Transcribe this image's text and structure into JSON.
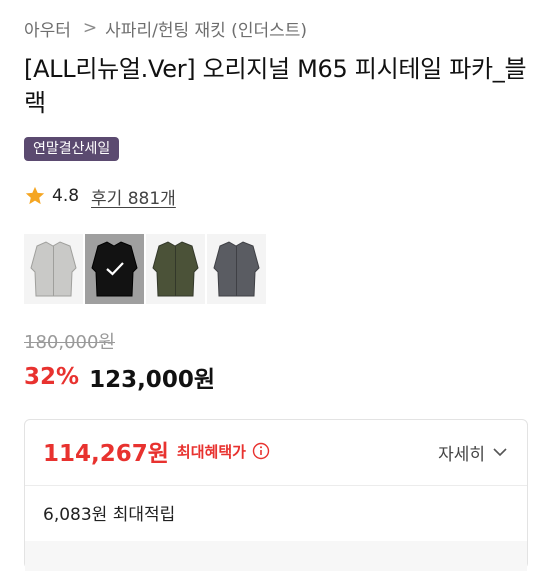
{
  "breadcrumb": {
    "category": "아우터",
    "separator": ">",
    "subcategory": "사파리/헌팅 재킷 (인더스트)"
  },
  "product": {
    "title": "[ALL리뉴얼.Ver] 오리지널 M65 피시테일 파카_블랙",
    "badge": "연말결산세일"
  },
  "rating": {
    "score": "4.8",
    "review_label": "후기 881개",
    "star_color": "#f5a623"
  },
  "options": {
    "thumbnails": [
      {
        "name": "light-gray-parka",
        "color": "#c9c9c7",
        "selected": false
      },
      {
        "name": "black-parka",
        "color": "#1c1c1c",
        "selected": true
      },
      {
        "name": "olive-parka",
        "color": "#4b5238",
        "selected": false
      },
      {
        "name": "charcoal-parka",
        "color": "#5a5c62",
        "selected": false
      }
    ]
  },
  "price": {
    "original": "180,000원",
    "discount_pct": "32%",
    "sale": "123,000원"
  },
  "benefit": {
    "max_benefit_price": "114,267원",
    "max_benefit_label": "최대혜택가",
    "detail_label": "자세히",
    "points": "6,083원 최대적립"
  },
  "colors": {
    "accent_red": "#e8322f",
    "badge_bg": "#5b4a70"
  }
}
